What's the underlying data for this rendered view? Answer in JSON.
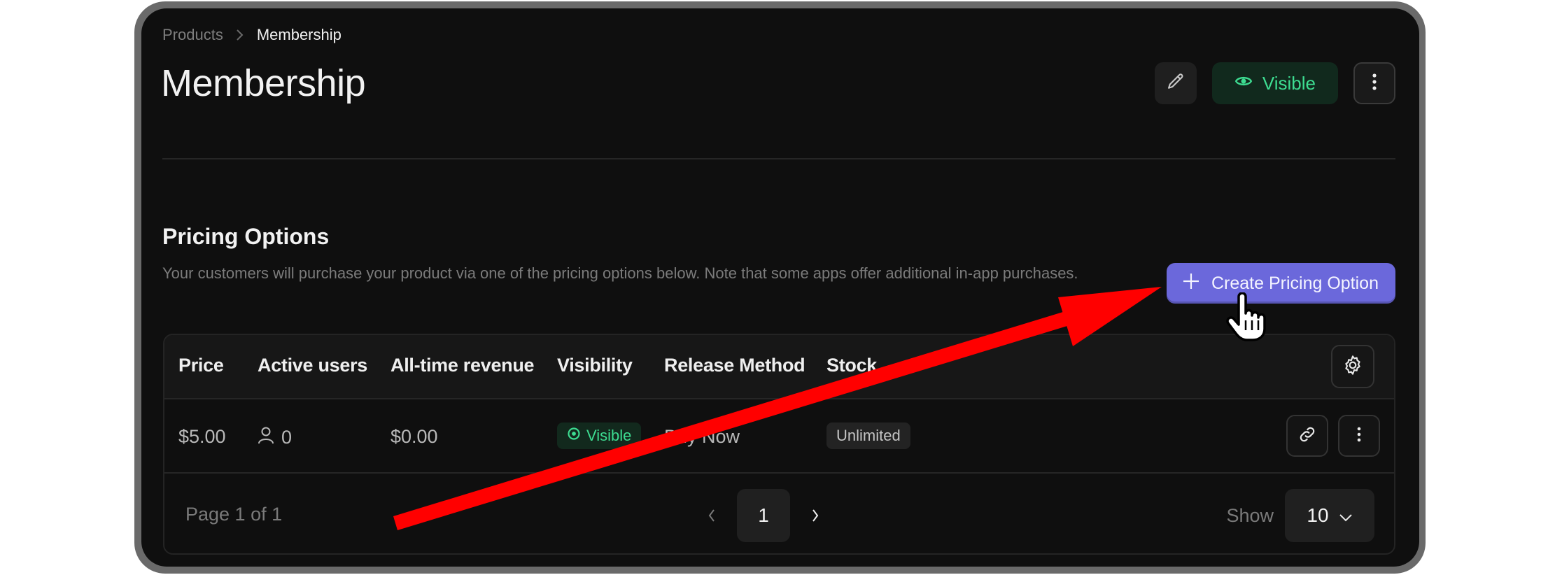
{
  "breadcrumb": {
    "parent": "Products",
    "current": "Membership"
  },
  "page": {
    "title": "Membership"
  },
  "header_actions": {
    "edit_icon": "pencil-icon",
    "visibility_label": "Visible",
    "visibility_icon": "eye-icon",
    "more_icon": "more-vertical-icon"
  },
  "pricing": {
    "title": "Pricing Options",
    "description": "Your customers will purchase your product via one of the pricing options below. Note that some apps offer additional in-app purchases.",
    "create_button_label": "Create Pricing Option",
    "create_button_icon": "plus-icon"
  },
  "table": {
    "columns": [
      "Price",
      "Active users",
      "All-time revenue",
      "Visibility",
      "Release Method",
      "Stock"
    ],
    "settings_icon": "gear-icon",
    "rows": [
      {
        "price": "$5.00",
        "active_users": "0",
        "active_users_icon": "user-icon",
        "revenue": "$0.00",
        "visibility": "Visible",
        "release_method": "Buy Now",
        "stock": "Unlimited",
        "link_icon": "link-icon",
        "more_icon": "more-vertical-icon"
      }
    ]
  },
  "pagination": {
    "page_info": "Page 1 of 1",
    "current_page": "1",
    "show_label": "Show",
    "page_size": "10"
  },
  "colors": {
    "accent": "#6b68db",
    "success": "#3ddc91",
    "success_bg": "#11291d",
    "background": "#0f0f0f",
    "annotation_arrow": "#ff0000"
  }
}
